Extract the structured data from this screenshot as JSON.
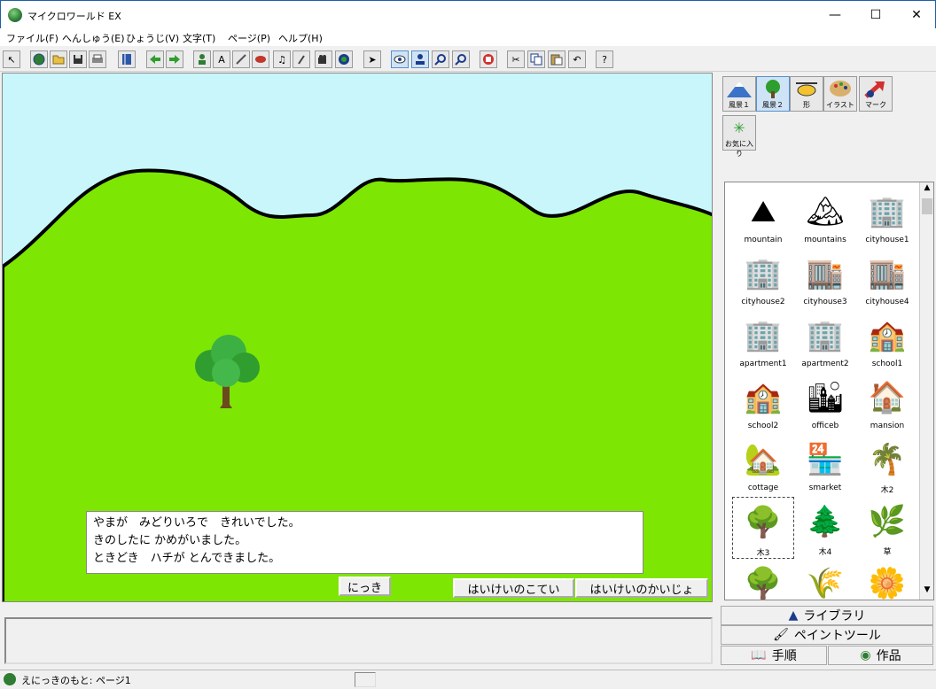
{
  "window": {
    "title": "マイクロワールド EX",
    "minimize": "—",
    "maximize": "☐",
    "close": "✕"
  },
  "menu": [
    "ファイル(F)",
    "へんしゅう(E)",
    "ひょうじ(V)",
    "文字(T)",
    "ページ(P)",
    "ヘルプ(H)"
  ],
  "toolbar": {
    "help": "?",
    "text_tool": "A"
  },
  "canvas": {
    "sky_color": "#c8f6fa",
    "grass_color": "#7ee603",
    "story_lines": [
      "やまが　みどりいろで　きれいでした。",
      "きのしたに かめがいました。",
      "ときどき　ハチが とんできました。"
    ],
    "diary_button": "にっき",
    "bg_front_button": "はいけいのこてい",
    "bg_clear_button": "はいけいのかいじょ"
  },
  "categories": [
    {
      "label": "風景１",
      "icon": "mountain-icon",
      "active": false
    },
    {
      "label": "風景２",
      "icon": "tree-icon",
      "active": true
    },
    {
      "label": "形",
      "icon": "helicopter-icon",
      "active": false
    },
    {
      "label": "イラスト",
      "icon": "palette-icon",
      "active": false
    },
    {
      "label": "マーク",
      "icon": "arrow-mark-icon",
      "active": false
    },
    {
      "label": "お気に入り",
      "icon": "favorite-icon",
      "active": false
    }
  ],
  "library_items": [
    {
      "label": "mountain",
      "emoji": "⛰"
    },
    {
      "label": "mountains",
      "emoji": "🏔"
    },
    {
      "label": "cityhouse1",
      "emoji": "🏢"
    },
    {
      "label": "cityhouse2",
      "emoji": "🏢"
    },
    {
      "label": "cityhouse3",
      "emoji": "🏬"
    },
    {
      "label": "cityhouse4",
      "emoji": "🏬"
    },
    {
      "label": "apartment1",
      "emoji": "🏢"
    },
    {
      "label": "apartment2",
      "emoji": "🏢"
    },
    {
      "label": "school1",
      "emoji": "🏫"
    },
    {
      "label": "school2",
      "emoji": "🏫"
    },
    {
      "label": "officeb",
      "emoji": "🏙"
    },
    {
      "label": "mansion",
      "emoji": "🏠"
    },
    {
      "label": "cottage",
      "emoji": "🏡"
    },
    {
      "label": "smarket",
      "emoji": "🏪"
    },
    {
      "label": "木2",
      "emoji": "🌴"
    },
    {
      "label": "木3",
      "emoji": "🌳",
      "selected": true
    },
    {
      "label": "木4",
      "emoji": "🌲"
    },
    {
      "label": "草",
      "emoji": "🌿"
    },
    {
      "label": "",
      "emoji": "🌳"
    },
    {
      "label": "",
      "emoji": "🌾"
    },
    {
      "label": "",
      "emoji": "🌼"
    }
  ],
  "panel_tabs": {
    "library": "ライブラリ",
    "paint": "ペイントツール",
    "steps": "手順",
    "works": "作品"
  },
  "status": {
    "text": "えにっきのもと: ページ1"
  }
}
